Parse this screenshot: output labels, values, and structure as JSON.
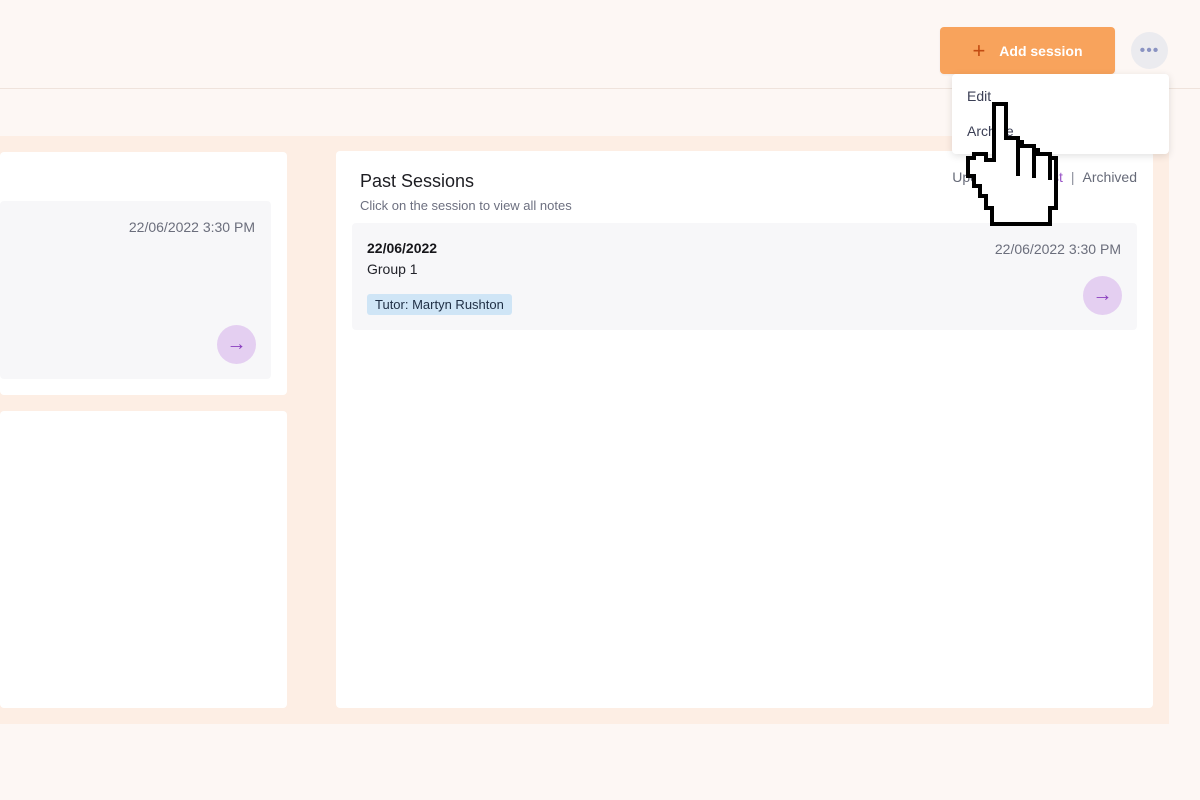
{
  "header": {
    "add_session_label": "Add session",
    "plus_glyph": "+",
    "more_glyph": "•••"
  },
  "dropdown": {
    "items": [
      {
        "label": "Edit"
      },
      {
        "label": "Archive"
      }
    ]
  },
  "left_panel": {
    "session_time": "22/06/2022 3:30 PM",
    "arrow_glyph": "→"
  },
  "past_sessions": {
    "title": "Past Sessions",
    "subtitle": "Click on the session to view all notes",
    "filter": {
      "upcoming": "Upcoming",
      "past": "Past",
      "archived": "Archived",
      "separator": "|"
    },
    "session": {
      "date": "22/06/2022",
      "time": "22/06/2022 3:30 PM",
      "group": "Group 1",
      "tutor": "Tutor: Martyn Rushton",
      "arrow_glyph": "→"
    }
  },
  "colors": {
    "accent_orange": "#f8a35c",
    "accent_purple": "#8a3fbf",
    "badge_blue": "#cfe5f6",
    "page_bg": "#fdf7f4",
    "content_bg": "#fdeee4"
  },
  "icons": {
    "plus": "plus-icon",
    "more": "more-horizontal-icon",
    "arrow": "arrow-right-icon",
    "cursor": "hand-pointer-cursor-icon"
  }
}
